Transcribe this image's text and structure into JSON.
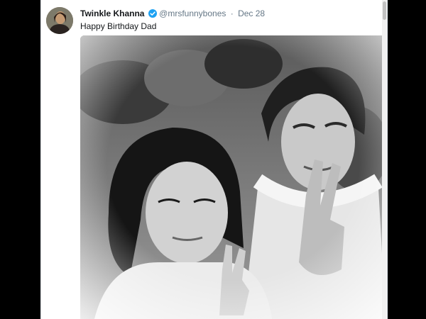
{
  "tweet": {
    "author_name": "Twinkle Khanna",
    "handle": "@mrsfunnybones",
    "separator": "·",
    "date": "Dec 28",
    "text": "Happy Birthday Dad",
    "verified_badge_color": "#1da1f2",
    "avatar_icon": "profile-photo",
    "media": "black-and-white-photo"
  }
}
